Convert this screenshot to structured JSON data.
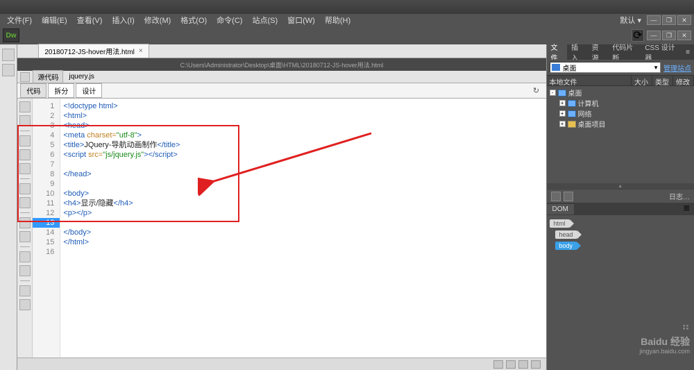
{
  "app": {
    "logo": "Dw"
  },
  "menu": {
    "file": "文件(F)",
    "edit": "编辑(E)",
    "view": "查看(V)",
    "insert": "插入(I)",
    "modify": "修改(M)",
    "format": "格式(O)",
    "command": "命令(C)",
    "site": "站点(S)",
    "window": "窗口(W)",
    "help": "帮助(H)",
    "defaults": "默认 ▾"
  },
  "wincontrols": {
    "min": "—",
    "max": "❐",
    "close": "✕"
  },
  "doc": {
    "tab_name": "20180712-JS-hover用法.html",
    "tab_close": "×",
    "path": "C:\\Users\\Administrator\\Desktop\\桌面\\HTML\\20180712-JS-hover用法.html",
    "src_btn": "源代码",
    "related_file": "jquery.js"
  },
  "views": {
    "code": "代码",
    "split": "拆分",
    "design": "设计",
    "refresh": "↻"
  },
  "code_lines": [
    "1",
    "2",
    "3",
    "4",
    "5",
    "6",
    "7",
    "8",
    "9",
    "10",
    "11",
    "12",
    "13",
    "14",
    "15",
    "16"
  ],
  "code": {
    "l1": "<!doctype html>",
    "l2": "<html>",
    "l3": "<head>",
    "l4a": "<meta ",
    "l4b": "charset=",
    "l4c": "\"utf-8\"",
    "l4d": ">",
    "l5a": "<title>",
    "l5b": "JQuery-导航动画制作",
    "l5c": "</title>",
    "l6a": "<script ",
    "l6b": "src=",
    "l6c": "\"js/jquery.js\"",
    "l6d": "></",
    "l6e": "script>",
    "l7": "",
    "l8": "</head>",
    "l9": "",
    "l10": "<body>",
    "l11a": "<h4>",
    "l11b": "显示/隐藏",
    "l11c": "</h4>",
    "l12": "<p></p>",
    "l13": "",
    "l14": "</body>",
    "l15": "</html>",
    "l16": ""
  },
  "right_tabs": {
    "files": "文件",
    "insert": "插入",
    "assets": "资源",
    "snippets": "代码片断",
    "css": "CSS 设计器"
  },
  "files_panel": {
    "site_label": "桌面",
    "dropdown_arrow": "▼",
    "manage": "管理站点",
    "cols": {
      "local": "本地文件",
      "size": "大小",
      "type": "类型",
      "modified": "修改"
    },
    "tree": {
      "root": "桌面",
      "pc": "计算机",
      "net": "网络",
      "proj": "桌面项目",
      "expand": "+",
      "collapse": "-"
    }
  },
  "log_label": "日志…",
  "dom_panel": {
    "title": "DOM",
    "html": "html",
    "head": "head",
    "body": "body"
  },
  "watermark": {
    "brand": "Baidu 经验",
    "url": "jingyan.baidu.com",
    "paw": "⠶"
  }
}
